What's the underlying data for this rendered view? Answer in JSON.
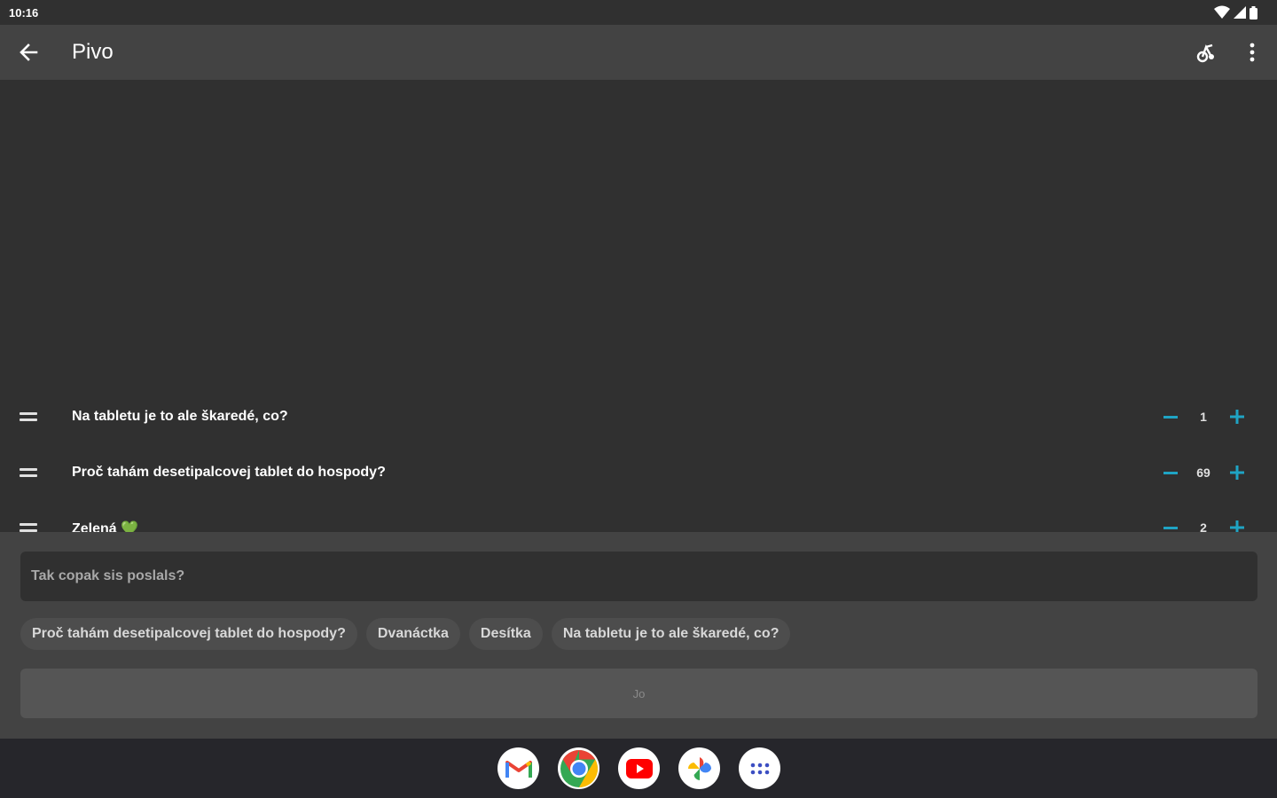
{
  "status": {
    "time": "10:16",
    "wifi_icon": "wifi-icon",
    "signal_icon": "signal-icon",
    "battery_icon": "battery-icon"
  },
  "appbar": {
    "title": "Pivo",
    "back_icon": "arrow-back-icon",
    "beer_icon": "beer-icon",
    "more_icon": "more-vert-icon"
  },
  "list": {
    "items": [
      {
        "label": "Na tabletu je to ale škaredé, co?",
        "count": "1"
      },
      {
        "label": "Proč tahám desetipalcovej tablet do hospody?",
        "count": "69"
      },
      {
        "label": "Zelená 💚",
        "count": "2"
      }
    ]
  },
  "input": {
    "placeholder": "Tak copak sis poslals?",
    "value": ""
  },
  "chips": [
    "Proč tahám desetipalcovej tablet do hospody?",
    "Dvanáctka",
    "Desítka",
    "Na tabletu je to ale škaredé, co?"
  ],
  "submit": {
    "label": "Jo"
  },
  "dock": {
    "apps": [
      "gmail-icon",
      "chrome-icon",
      "youtube-icon",
      "photos-icon",
      "app-drawer-icon"
    ]
  },
  "colors": {
    "accent": "#1fa4c4",
    "appbar": "#434343",
    "background": "#303030",
    "navbar": "#26262b"
  }
}
